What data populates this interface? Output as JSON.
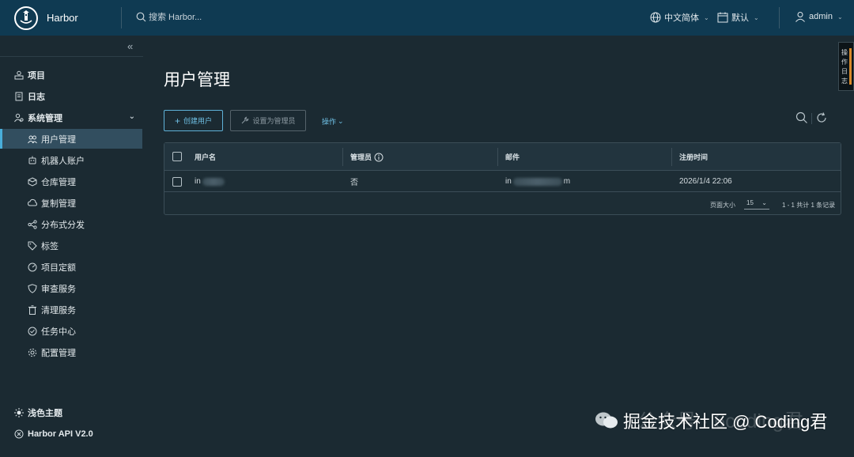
{
  "header": {
    "brand": "Harbor",
    "search_placeholder": "搜索 Harbor...",
    "language": "中文简体",
    "theme": "默认",
    "user": "admin"
  },
  "sidebar": {
    "top_items": [
      {
        "label": "项目",
        "icon": "projects-icon"
      },
      {
        "label": "日志",
        "icon": "logs-icon"
      },
      {
        "label": "系统管理",
        "icon": "admin-icon"
      }
    ],
    "sub_items": [
      {
        "label": "用户管理",
        "icon": "users-icon",
        "active": true
      },
      {
        "label": "机器人账户",
        "icon": "robot-icon"
      },
      {
        "label": "仓库管理",
        "icon": "registry-icon"
      },
      {
        "label": "复制管理",
        "icon": "replication-icon"
      },
      {
        "label": "分布式分发",
        "icon": "distribution-icon"
      },
      {
        "label": "标签",
        "icon": "tag-icon"
      },
      {
        "label": "项目定额",
        "icon": "quota-icon"
      },
      {
        "label": "审查服务",
        "icon": "shield-icon"
      },
      {
        "label": "清理服务",
        "icon": "trash-icon"
      },
      {
        "label": "任务中心",
        "icon": "job-icon"
      },
      {
        "label": "配置管理",
        "icon": "gear-icon"
      }
    ],
    "bottom_items": [
      {
        "label": "浅色主题",
        "icon": "sun-icon"
      },
      {
        "label": "Harbor API V2.0",
        "icon": "api-icon"
      }
    ]
  },
  "main": {
    "title": "用户管理",
    "create_button": "创建用户",
    "set_admin_button": "设置为管理员",
    "actions_label": "操作"
  },
  "table": {
    "headers": [
      "用户名",
      "管理员",
      "邮件",
      "注册时间"
    ],
    "rows": [
      {
        "username_visible": "in",
        "admin": "否",
        "email_start": "in",
        "email_end": "m",
        "registered": "2026/1/4 22:06"
      }
    ],
    "page_size_label": "页面大小",
    "page_size": "15",
    "summary": "1 - 1 共计 1 条记录"
  },
  "edge_tab": [
    "操",
    "作",
    "日",
    "志"
  ],
  "watermark": "掘金技术社区 @ Coding君",
  "watermark_ghost": "公众号 · 6coding君",
  "colors": {
    "header_bg": "#0f3a52",
    "page_bg": "#1b2a32",
    "accent": "#49aeda",
    "active_bg": "#324e5f"
  }
}
